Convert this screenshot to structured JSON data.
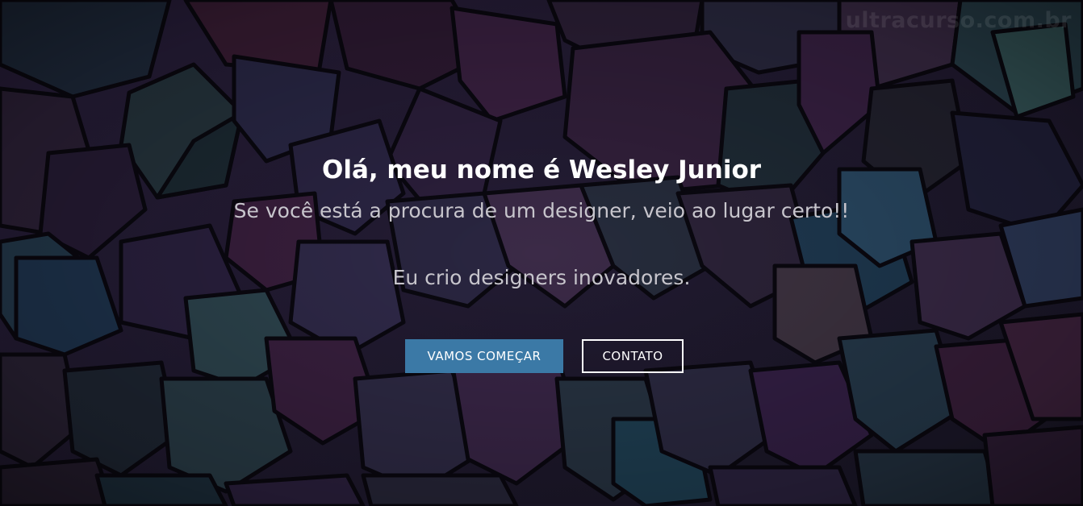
{
  "watermark": "ultracurso.com.br",
  "hero": {
    "title": "Olá, meu nome é Wesley Junior",
    "subtitle": "Se você está a procura de um designer, veio ao lugar certo!!",
    "tagline": "Eu crio designers inovadores.",
    "primary_button": "VAMOS COMEÇAR",
    "secondary_button": "CONTATO"
  },
  "colors": {
    "primary_button": "#3b79a6",
    "title_text": "#ffffff",
    "subtitle_text": "#c7c5cc",
    "background_dark": "#16121e"
  }
}
